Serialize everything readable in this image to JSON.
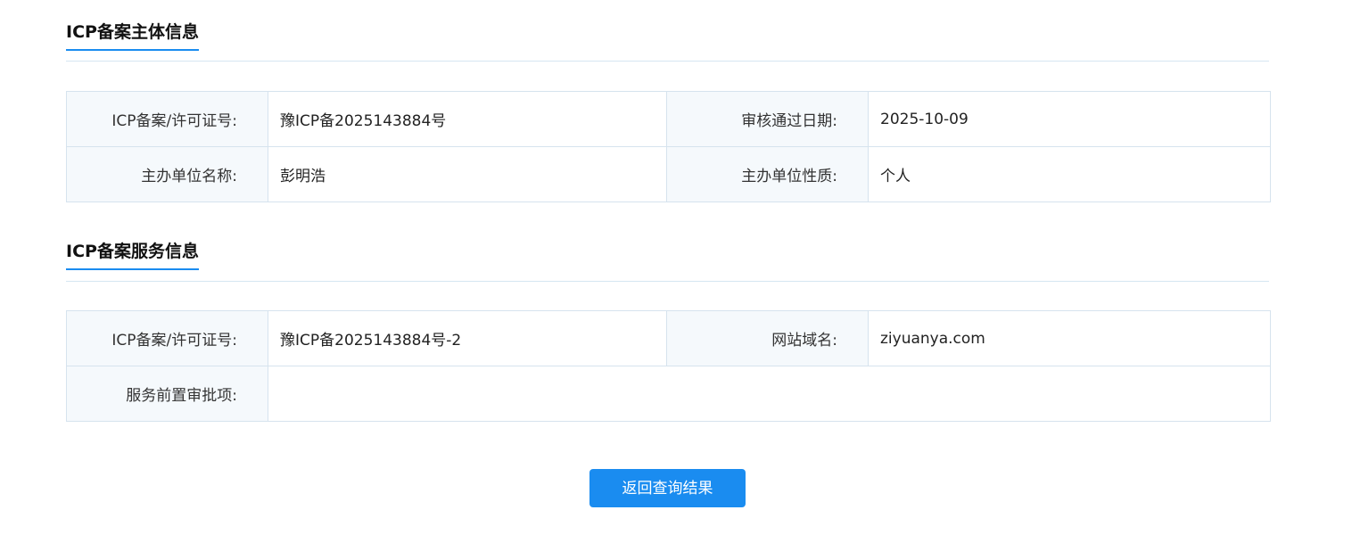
{
  "sections": {
    "entity": {
      "title": "ICP备案主体信息",
      "rows": [
        {
          "label1": "ICP备案/许可证号:",
          "value1": "豫ICP备2025143884号",
          "label2": "审核通过日期:",
          "value2": "2025-10-09"
        },
        {
          "label1": "主办单位名称:",
          "value1": "彭明浩",
          "label2": "主办单位性质:",
          "value2": "个人"
        }
      ]
    },
    "service": {
      "title": "ICP备案服务信息",
      "row1": {
        "label1": "ICP备案/许可证号:",
        "value1": "豫ICP备2025143884号-2",
        "label2": "网站域名:",
        "value2": "ziyuanya.com"
      },
      "row2": {
        "label": "服务前置审批项:",
        "value": ""
      }
    }
  },
  "actions": {
    "back_label": "返回查询结果"
  },
  "colors": {
    "accent": "#1a8cf0",
    "label_bg": "#f5f9fc",
    "border": "#d6e3ee"
  }
}
